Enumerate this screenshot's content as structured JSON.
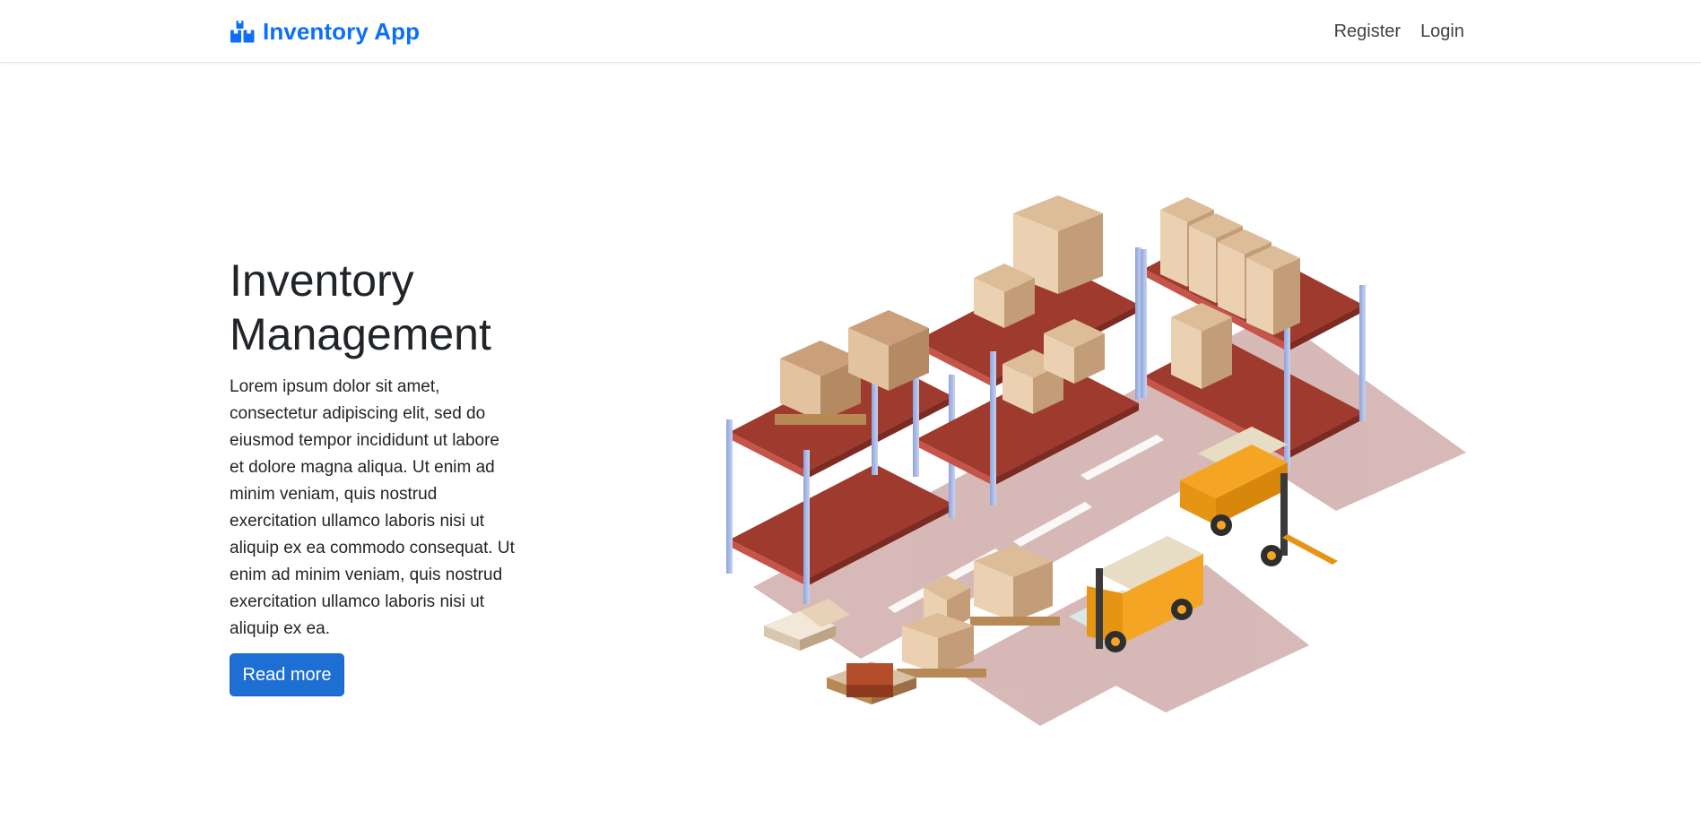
{
  "navbar": {
    "brand": {
      "icon": "boxes-icon",
      "label": "Inventory App"
    },
    "links": [
      {
        "label": "Register"
      },
      {
        "label": "Login"
      }
    ]
  },
  "hero": {
    "title_line1": "Inventory",
    "title_line2": "Management",
    "body": "Lorem ipsum dolor sit amet, consectetur adipiscing elit, sed do eiusmod tempor incididunt ut labore et dolore magna aliqua. Ut enim ad minim veniam, quis nostrud exercitation ullamco laboris nisi ut aliquip ex ea commodo consequat. Ut enim ad minim veniam, quis nostrud exercitation ullamco laboris nisi ut aliquip ex ea.",
    "button_label": "Read more",
    "illustration": "warehouse-illustration"
  },
  "colors": {
    "brand": "#0d6efd",
    "button": "#1e6fd4",
    "shelf": "#9e3a2e",
    "forklift": "#f5a524",
    "box": "#d9b48c"
  }
}
